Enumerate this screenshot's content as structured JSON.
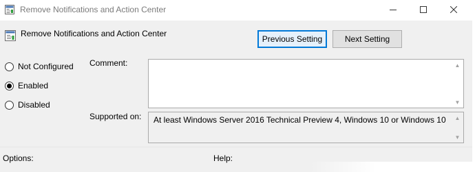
{
  "window": {
    "title": "Remove Notifications and Action Center",
    "icons": [
      "policy-icon",
      "minimize-icon",
      "maximize-icon",
      "close-icon"
    ]
  },
  "header": {
    "title": "Remove Notifications and Action Center"
  },
  "buttons": {
    "previous": "Previous Setting",
    "next": "Next Setting"
  },
  "state": {
    "options": [
      "Not Configured",
      "Enabled",
      "Disabled"
    ],
    "selected": "Enabled"
  },
  "comment": {
    "label": "Comment:",
    "value": ""
  },
  "supported": {
    "label": "Supported on:",
    "value": "At least Windows Server 2016 Technical Preview 4, Windows 10 or Windows 10"
  },
  "sections": {
    "options_label": "Options:",
    "help_label": "Help:"
  },
  "colors": {
    "accent": "#0078d7",
    "background": "#f0f0f0"
  }
}
